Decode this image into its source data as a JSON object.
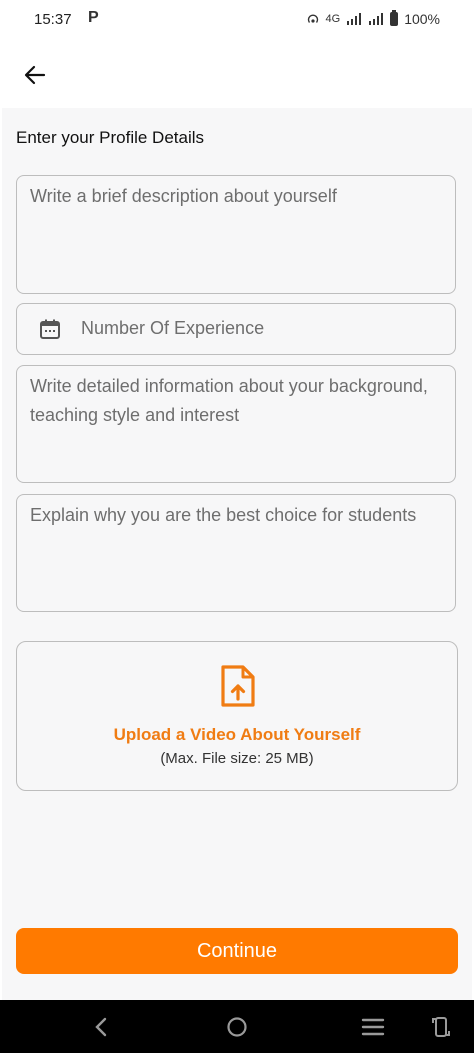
{
  "status_bar": {
    "time": "15:37",
    "app_glyph": "P",
    "network": "4G",
    "battery": "100%"
  },
  "app_bar": {
    "back_icon": "arrow-left-icon"
  },
  "form": {
    "title": "Enter your Profile Details",
    "description_placeholder": "Write a brief description about yourself",
    "experience_placeholder": "Number Of Experience",
    "background_placeholder": "Write detailed information about your background, teaching style and interest",
    "why_placeholder": "Explain why you are the best choice for students"
  },
  "upload": {
    "label": "Upload a Video About Yourself",
    "note": "(Max. File size: 25 MB)",
    "icon": "file-upload-icon",
    "accent_color": "#f07c13"
  },
  "continue_label": "Continue",
  "colors": {
    "primary": "#ff7a00",
    "background": "#f7f7f8",
    "border": "#bdbdbd"
  }
}
